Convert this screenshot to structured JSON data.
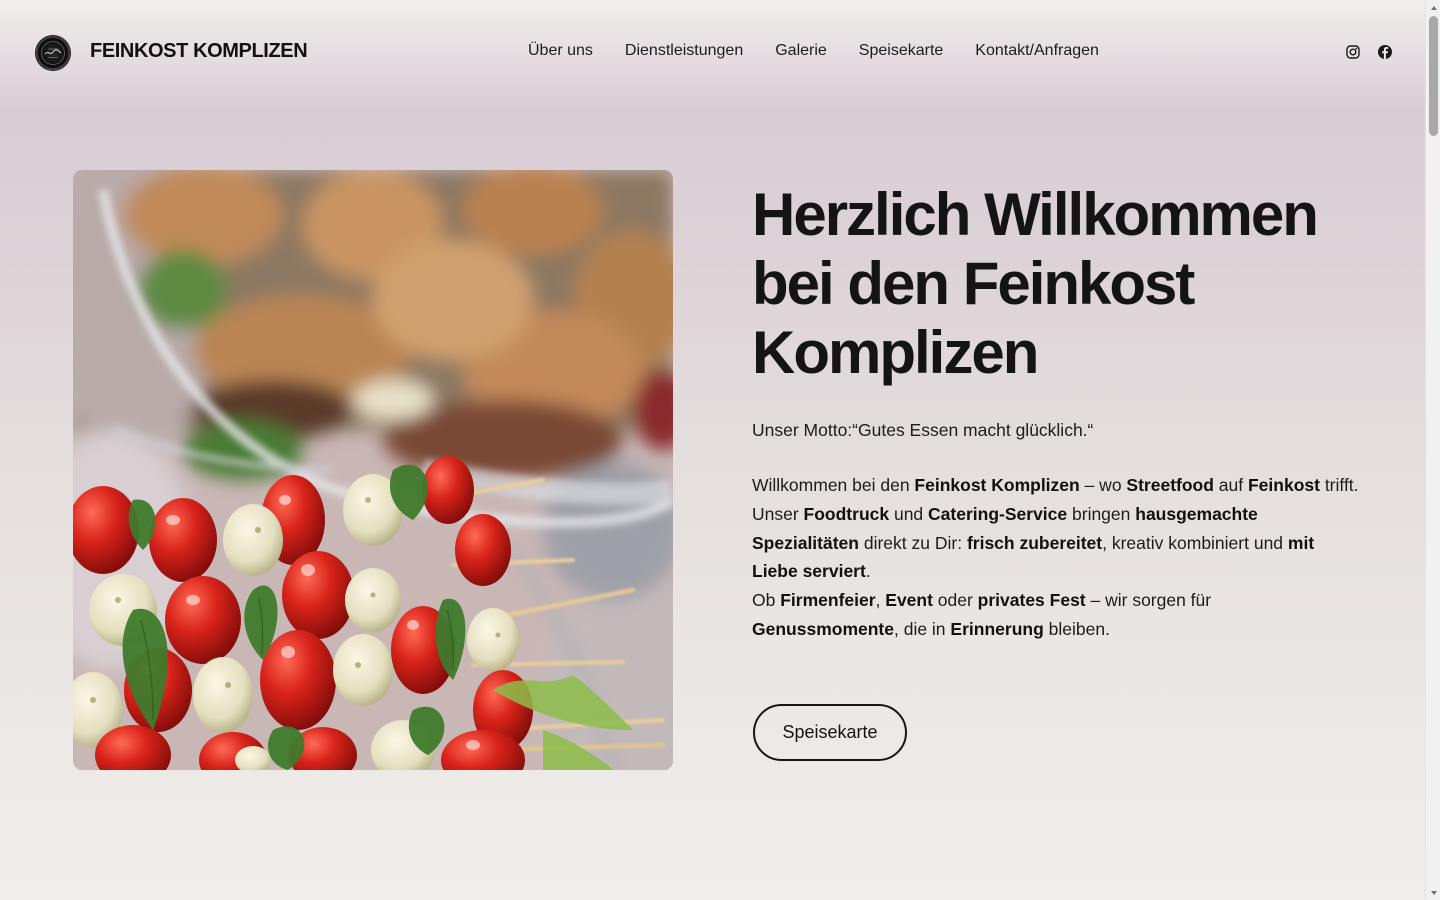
{
  "header": {
    "brand": "FEINKOST KOMPLIZEN",
    "logo_icon": "brand-logo-icon",
    "nav": [
      {
        "label": "Über uns"
      },
      {
        "label": "Dienstleistungen"
      },
      {
        "label": "Galerie"
      },
      {
        "label": "Speisekarte"
      },
      {
        "label": "Kontakt/Anfragen"
      }
    ],
    "social": [
      {
        "icon": "instagram-icon"
      },
      {
        "icon": "facebook-icon"
      }
    ]
  },
  "hero": {
    "image_icon": "food-skewers-photo",
    "title": "Herzlich Willkommen bei den Feinkost Komplizen",
    "motto": "Unser Motto:“Gutes Essen macht glücklich.“",
    "intro": [
      [
        {
          "t": "Willkommen bei den "
        },
        {
          "t": "Feinkost Komplizen",
          "b": true
        },
        {
          "t": " – wo "
        },
        {
          "t": "Streetfood",
          "b": true
        },
        {
          "t": " auf "
        },
        {
          "t": "Feinkost",
          "b": true
        },
        {
          "t": " trifft."
        }
      ],
      [
        {
          "t": "Unser "
        },
        {
          "t": "Foodtruck",
          "b": true
        },
        {
          "t": " und "
        },
        {
          "t": "Catering-Service",
          "b": true
        },
        {
          "t": " bringen "
        },
        {
          "t": "hausgemachte Spezialitäten",
          "b": true
        },
        {
          "t": " direkt zu Dir: "
        },
        {
          "t": "frisch zubereitet",
          "b": true
        },
        {
          "t": ", kreativ kombiniert und "
        },
        {
          "t": "mit Liebe serviert",
          "b": true
        },
        {
          "t": "."
        }
      ],
      [
        {
          "t": "Ob "
        },
        {
          "t": "Firmenfeier",
          "b": true
        },
        {
          "t": ", "
        },
        {
          "t": "Event",
          "b": true
        },
        {
          "t": " oder "
        },
        {
          "t": "privates Fest",
          "b": true
        },
        {
          "t": " – wir sorgen für "
        },
        {
          "t": "Genussmomente",
          "b": true
        },
        {
          "t": ", die in "
        },
        {
          "t": "Erinnerung",
          "b": true
        },
        {
          "t": " bleiben."
        }
      ]
    ],
    "cta_label": "Speisekarte"
  },
  "colors": {
    "text": "#161616",
    "bg_top": "#f2efed",
    "bg_mauve": "#d8ccd5",
    "bg_bottom": "#f0eeea",
    "tomato": "#c81c14",
    "basil": "#3f7a2c"
  }
}
